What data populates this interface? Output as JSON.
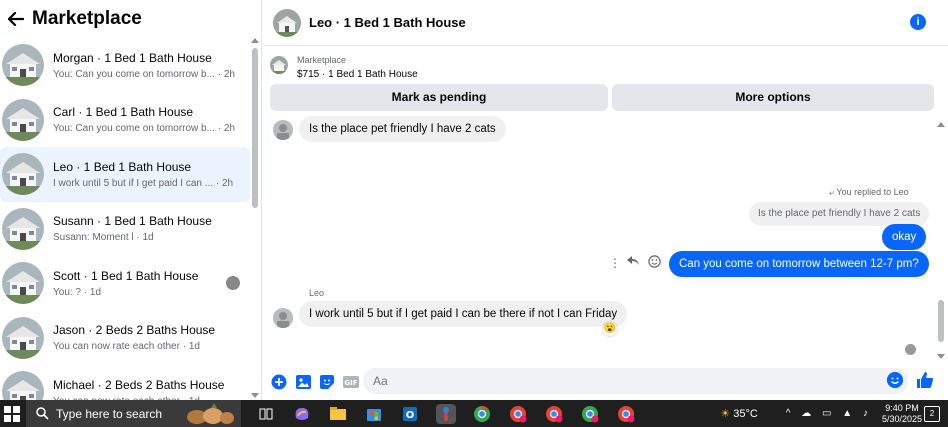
{
  "sidebar": {
    "title": "Marketplace",
    "conversations": [
      {
        "title": "Morgan · 1 Bed 1 Bath House",
        "subtitle": "You: Can you come on tomorrow b... · 2h",
        "active": false,
        "badge": false
      },
      {
        "title": "Carl · 1 Bed 1 Bath House",
        "subtitle": "You: Can you come on tomorrow b... · 2h",
        "active": false,
        "badge": false
      },
      {
        "title": "Leo · 1 Bed 1 Bath House",
        "subtitle": "I work until 5 but if I get paid I can ... · 2h",
        "active": true,
        "badge": false
      },
      {
        "title": "Susann · 1 Bed 1 Bath House",
        "subtitle": "Susann: Moment l · 1d",
        "active": false,
        "badge": false
      },
      {
        "title": "Scott · 1 Bed 1 Bath House",
        "subtitle": "You: ? · 1d",
        "active": false,
        "badge": true
      },
      {
        "title": "Jason · 2 Beds 2 Baths House",
        "subtitle": "You can now rate each other · 1d",
        "active": false,
        "badge": false
      },
      {
        "title": "Michael · 2 Beds 2 Baths House",
        "subtitle": "You can now rate each other · 1d",
        "active": false,
        "badge": false
      }
    ]
  },
  "chat": {
    "title": "Leo · 1 Bed 1 Bath House",
    "marketplace_label": "Marketplace",
    "listing": "$715 · 1 Bed 1 Bath House",
    "mark_pending": "Mark as pending",
    "more_options": "More options",
    "messages": {
      "m1": "Is the place pet friendly I have 2 cats",
      "replied_label": "You replied to Leo",
      "quoted": "Is the place pet friendly I have 2 cats",
      "m2": "okay",
      "m3": "Can you come on tomorrow between 12-7 pm?",
      "sender": "Leo",
      "m4": "I work until 5 but if I get paid I can be there if not I can Friday"
    },
    "composer_placeholder": "Aa"
  },
  "taskbar": {
    "search_placeholder": "Type here to search",
    "temperature": "35°C",
    "time": "9:40 PM",
    "date": "5/30/2025",
    "notifications": "2"
  },
  "colors": {
    "accent": "#0866ff",
    "active_row": "#ebf4fe",
    "bubble_in": "#f0f0f0",
    "button_bg": "#e4e6eb"
  }
}
